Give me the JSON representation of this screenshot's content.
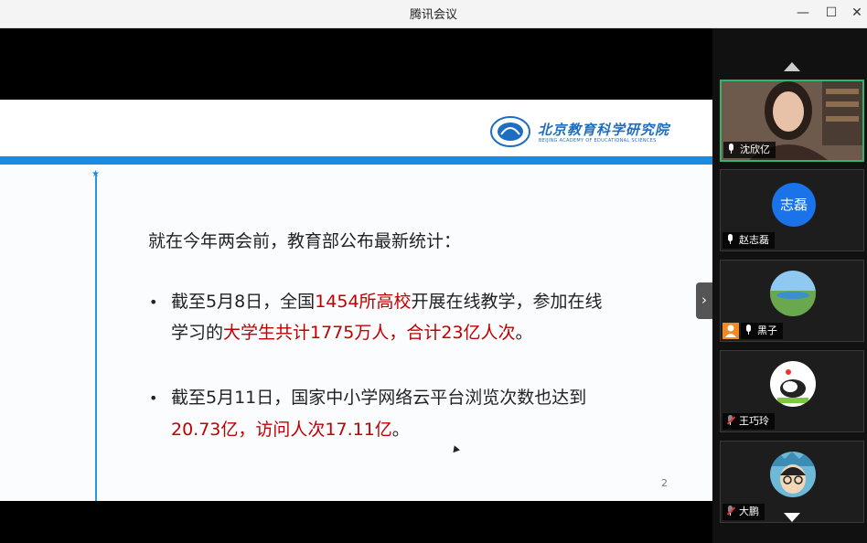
{
  "window": {
    "title": "腾讯会议"
  },
  "slide": {
    "logo_cn": "北京教育科学研究院",
    "logo_en": "BEIJING ACADEMY OF EDUCATIONAL SCIENCES",
    "heading": "就在今年两会前，教育部公布最新统计：",
    "bullet1": {
      "p1": "截至5月8日，全国",
      "r1": "1454所高校",
      "p2": "开展在线教学，参加在线",
      "p3": "学习的",
      "r2": "大学生共计1775万人，合计23亿人次",
      "p4": "。"
    },
    "bullet2": {
      "p1": "截至5月11日，国家中小学网络云平台浏览次数也达到",
      "r1": "20.73亿，访问人次17.11亿",
      "p2": "。"
    },
    "page_number": "2"
  },
  "participants": [
    {
      "name": "沈欣亿",
      "mic": "on",
      "active": true
    },
    {
      "name": "赵志磊",
      "mic": "on",
      "avatar_text": "志磊"
    },
    {
      "name": "黑子",
      "mic": "on",
      "host": true
    },
    {
      "name": "王巧玲",
      "mic": "muted"
    },
    {
      "name": "大鹏",
      "mic": "muted"
    }
  ],
  "colors": {
    "accent_blue": "#1a8be0",
    "highlight_red": "#c00000",
    "active_border": "#2fb56e",
    "host_badge": "#f08a24"
  },
  "icons": [
    "minimize-icon",
    "maximize-icon",
    "close-icon",
    "chevron-right-icon",
    "scroll-up-icon",
    "scroll-down-icon",
    "microphone-icon",
    "muted-microphone-icon",
    "host-badge-icon"
  ]
}
